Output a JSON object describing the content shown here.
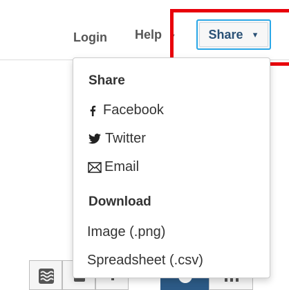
{
  "nav": {
    "login_label": "Login",
    "help_label": "Help",
    "help_caret": "▼",
    "share_label": "Share",
    "share_caret": "▼"
  },
  "dropdown": {
    "share_heading": "Share",
    "share_items": [
      {
        "icon": "facebook-icon",
        "label": "Facebook"
      },
      {
        "icon": "twitter-icon",
        "label": "Twitter"
      },
      {
        "icon": "email-icon",
        "label": "Email"
      }
    ],
    "download_heading": "Download",
    "download_items": [
      {
        "label": "Image (.png)"
      },
      {
        "label": "Spreadsheet (.csv)"
      }
    ]
  },
  "colors": {
    "highlight": "#e8000b",
    "share_border": "#2aa7e7",
    "share_text": "#2a5176",
    "toolbar_active": "#2c5a86"
  },
  "toolbar": {
    "icons": [
      "wave-chart-icon",
      "bar-icon",
      "sort-icon",
      "map-icon",
      "columns-icon"
    ]
  }
}
